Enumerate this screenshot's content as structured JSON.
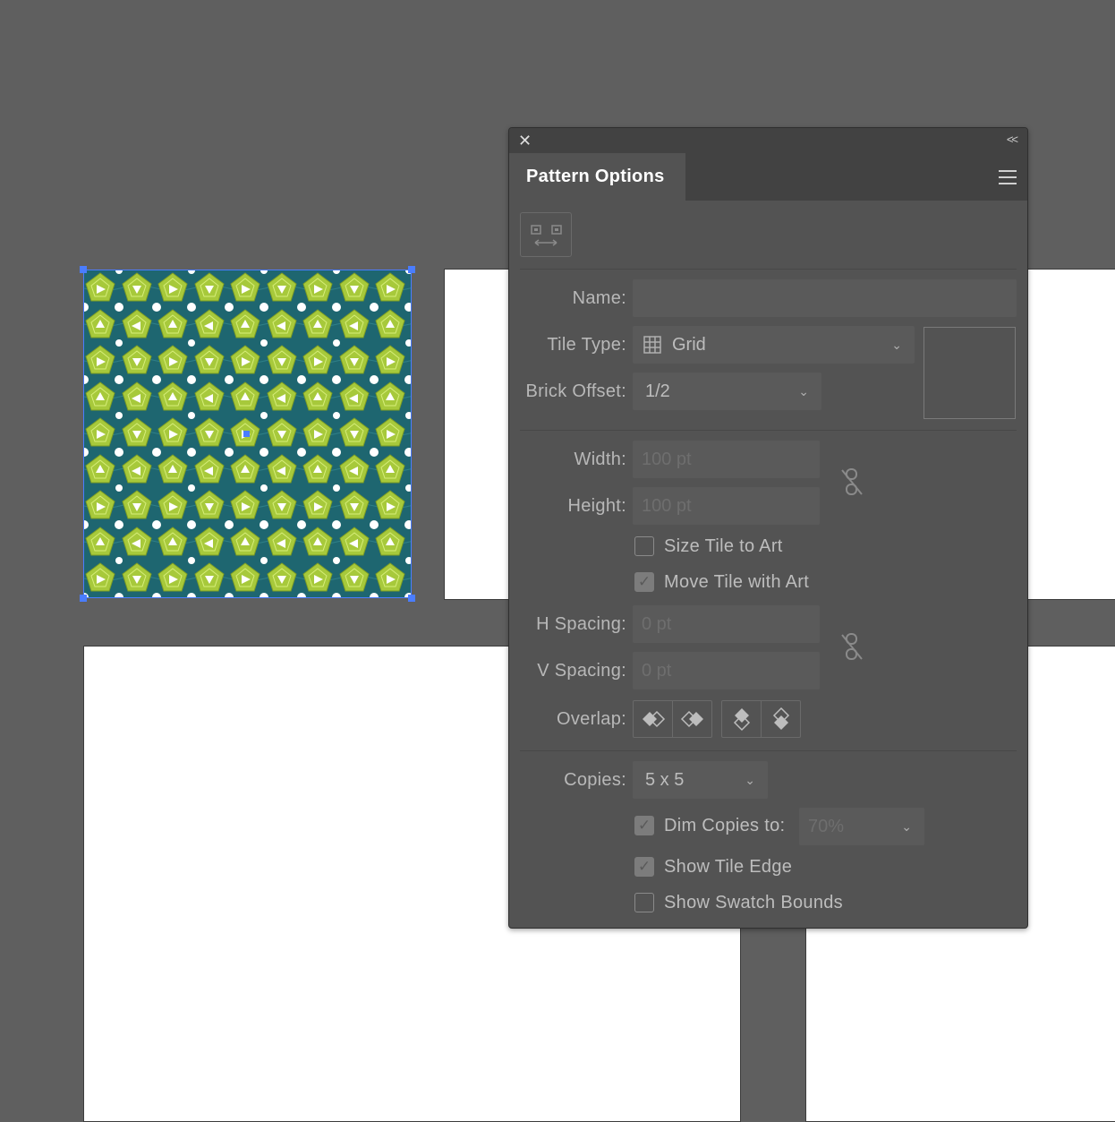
{
  "panel": {
    "title": "Pattern Options",
    "name_label": "Name:",
    "name_value": "",
    "tile_type_label": "Tile Type:",
    "tile_type_value": "Grid",
    "brick_offset_label": "Brick Offset:",
    "brick_offset_value": "1/2",
    "width_label": "Width:",
    "width_value": "100 pt",
    "height_label": "Height:",
    "height_value": "100 pt",
    "size_tile_label": "Size Tile to Art",
    "size_tile_checked": false,
    "move_tile_label": "Move Tile with Art",
    "move_tile_checked": true,
    "h_spacing_label": "H Spacing:",
    "h_spacing_value": "0 pt",
    "v_spacing_label": "V Spacing:",
    "v_spacing_value": "0 pt",
    "overlap_label": "Overlap:",
    "copies_label": "Copies:",
    "copies_value": "5 x 5",
    "dim_copies_label": "Dim Copies to:",
    "dim_copies_checked": true,
    "dim_copies_value": "70%",
    "show_tile_edge_label": "Show Tile Edge",
    "show_tile_edge_checked": true,
    "show_swatch_bounds_label": "Show Swatch Bounds",
    "show_swatch_bounds_checked": false
  },
  "icons": {
    "close": "close-icon",
    "collapse": "double-chevron-left-icon",
    "menu": "hamburger-menu-icon",
    "tile_tool": "pattern-tile-tool-icon",
    "grid": "grid-icon",
    "link": "unlinked-chain-icon"
  },
  "colors": {
    "canvas": "#5f5f5f",
    "panel": "#535353",
    "selection": "#4a7dff",
    "pattern_bg": "#1e6670",
    "pattern_shape": "#a7c93b"
  }
}
